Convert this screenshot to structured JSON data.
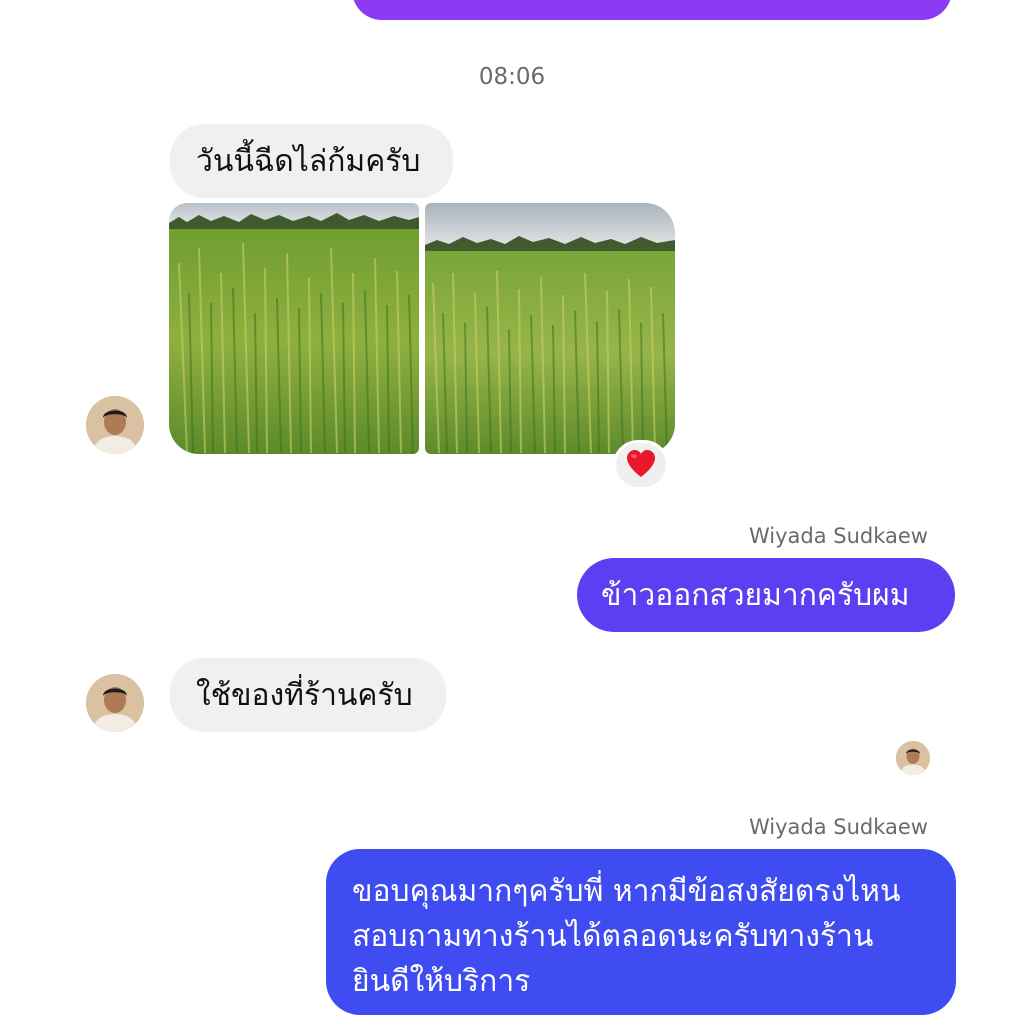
{
  "conversation": {
    "time_divider": "08:06",
    "messages": [
      {
        "direction": "incoming",
        "text": "วันนี้ฉีดไล่ก้มครับ"
      },
      {
        "direction": "incoming",
        "type": "photos",
        "photo_count": 2,
        "reaction": "heart"
      },
      {
        "direction": "outgoing",
        "sender": "Wiyada Sudkaew",
        "text": "ข้าวออกสวยมากครับผม"
      },
      {
        "direction": "incoming",
        "text": "ใช้ของที่ร้านครับ"
      },
      {
        "direction": "outgoing",
        "sender": "Wiyada Sudkaew",
        "lines": [
          "ขอบคุณมากๆครับพี่ หากมีข้อสงสัยตรงไหน",
          "สอบถามทางร้านได้ตลอดนะครับทางร้าน",
          "ยินดีให้บริการ"
        ]
      }
    ]
  },
  "colors": {
    "outgoing_purple": "#8a3bf3",
    "outgoing_violet": "#5b3ff2",
    "outgoing_blue": "#3f4cf2",
    "incoming_bg": "#f0f0f0",
    "reaction_heart": "#e8182a"
  },
  "icons": {
    "reaction": "heart-icon",
    "avatar": "contact-avatar",
    "seen": "seen-avatar-icon"
  }
}
